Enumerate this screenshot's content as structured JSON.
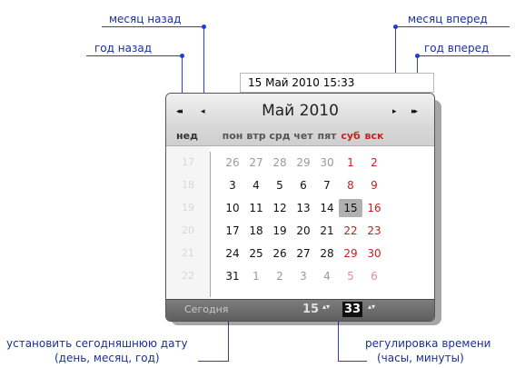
{
  "annotations": {
    "month_back": "месяц назад",
    "year_back": "год назад",
    "month_forward": "месяц вперед",
    "year_forward": "год вперед",
    "today_line1": "установить сегодняшнюю дату",
    "today_line2": "(день, месяц, год)",
    "time_line1": "регулировка времени",
    "time_line2": "(часы, минуты)"
  },
  "input": {
    "value": "15 Май 2010 15:33"
  },
  "calendar": {
    "nav": {
      "prev_year": "◂◂",
      "prev_month": "◂",
      "next_month": "▸",
      "next_year": "▸▸"
    },
    "title": "Май 2010",
    "week_header": "нед",
    "weekdays": [
      "пон",
      "втр",
      "срд",
      "чет",
      "пят",
      "суб",
      "вск"
    ],
    "weeks": [
      {
        "num": "17",
        "days": [
          "26",
          "27",
          "28",
          "29",
          "30",
          "1",
          "2"
        ]
      },
      {
        "num": "18",
        "days": [
          "3",
          "4",
          "5",
          "6",
          "7",
          "8",
          "9"
        ]
      },
      {
        "num": "19",
        "days": [
          "10",
          "11",
          "12",
          "13",
          "14",
          "15",
          "16"
        ]
      },
      {
        "num": "20",
        "days": [
          "17",
          "18",
          "19",
          "20",
          "21",
          "22",
          "23"
        ]
      },
      {
        "num": "21",
        "days": [
          "24",
          "25",
          "26",
          "27",
          "28",
          "29",
          "30"
        ]
      },
      {
        "num": "22",
        "days": [
          "31",
          "1",
          "2",
          "3",
          "4",
          "5",
          "6"
        ]
      }
    ],
    "selected_day": "15",
    "footer": {
      "today": "Сегодня",
      "hours": "15",
      "minutes": "33",
      "spinner": "▴▾"
    }
  },
  "colors": {
    "annotation": "#1a2f9e",
    "weekend": "#c81e1e",
    "line": "#2a3fd0"
  }
}
